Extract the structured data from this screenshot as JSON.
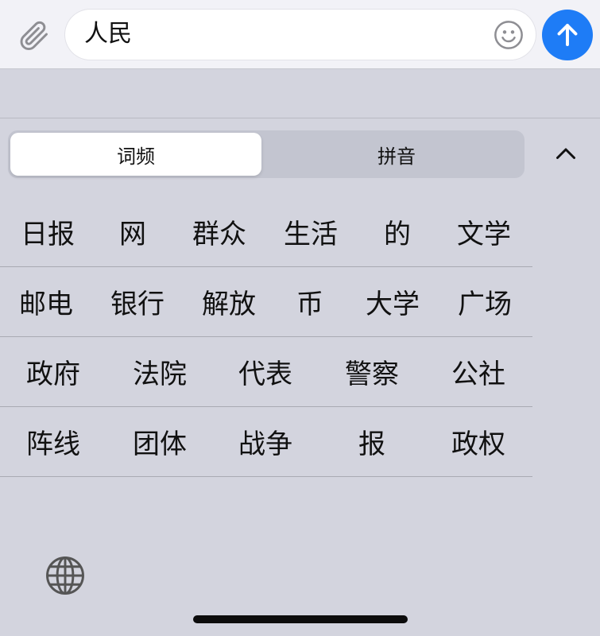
{
  "composer": {
    "input_value": "人民",
    "attach_icon": "paperclip-icon",
    "emoji_icon": "emoji-icon",
    "send_icon": "arrow-up-icon",
    "send_color": "#1e7cf6"
  },
  "segmented": {
    "tabs": [
      {
        "label": "词频",
        "selected": true
      },
      {
        "label": "拼音",
        "selected": false
      }
    ],
    "collapse_icon": "chevron-up-icon"
  },
  "candidates": {
    "rows": [
      [
        "日报",
        "网",
        "群众",
        "生活",
        "的",
        "文学"
      ],
      [
        "邮电",
        "银行",
        "解放",
        "币",
        "大学",
        "广场"
      ],
      [
        "政府",
        "法院",
        "代表",
        "警察",
        "公社"
      ],
      [
        "阵线",
        "团体",
        "战争",
        "报",
        "政权"
      ]
    ]
  },
  "keyboard": {
    "globe_icon": "globe-icon"
  }
}
